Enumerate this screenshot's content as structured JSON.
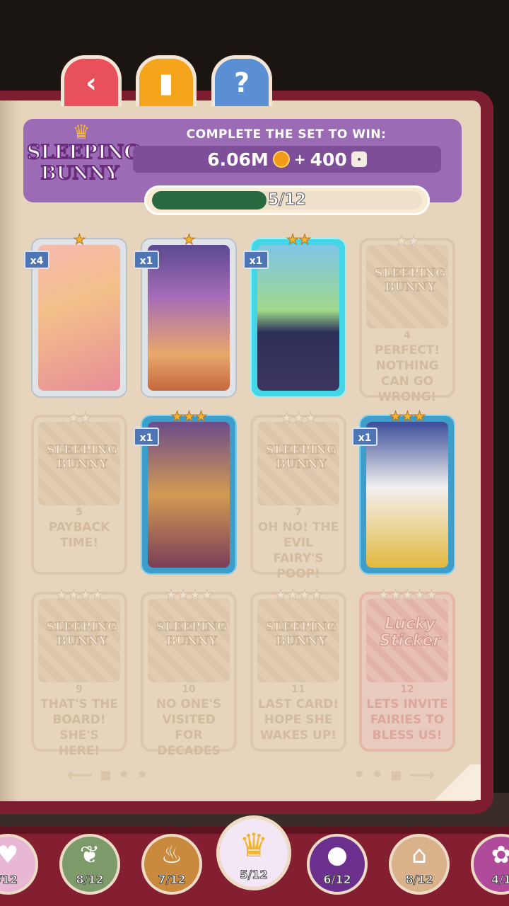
{
  "nav": {
    "back_icon": "‹",
    "cards_icon": "▮",
    "help_icon": "?"
  },
  "set": {
    "logo_line1": "SLEEPING",
    "logo_line2": "BUNNY",
    "complete_text": "COMPLETE THE SET TO WIN:",
    "reward_coins": "6.06M",
    "plus": "+",
    "reward_dice": "400",
    "progress_text": "5/12",
    "progress_fraction": 0.4167
  },
  "cards": [
    {
      "count": "x4",
      "stars": 1,
      "state": "owned",
      "frame": "silver"
    },
    {
      "count": "x1",
      "stars": 1,
      "state": "owned",
      "frame": "silver"
    },
    {
      "count": "x1",
      "stars": 2,
      "state": "owned",
      "frame": "cyan"
    },
    {
      "number": "4",
      "name": "PERFECT! NOTHING CAN GO WRONG!",
      "stars": 2,
      "state": "missing"
    },
    {
      "number": "5",
      "name": "PAYBACK TIME!",
      "stars": 2,
      "state": "missing"
    },
    {
      "count": "x1",
      "stars": 3,
      "state": "owned",
      "frame": "blue"
    },
    {
      "number": "7",
      "name": "OH NO! THE EVIL FAIRY'S POOP!",
      "stars": 3,
      "state": "missing"
    },
    {
      "count": "x1",
      "stars": 3,
      "state": "owned",
      "frame": "blue"
    },
    {
      "number": "9",
      "name": "THAT'S THE BOARD! SHE'S HERE!",
      "stars": 4,
      "state": "missing"
    },
    {
      "number": "10",
      "name": "NO ONE'S VISITED FOR DECADES",
      "stars": 4,
      "state": "missing"
    },
    {
      "number": "11",
      "name": "LAST CARD! HOPE SHE WAKES UP!",
      "stars": 4,
      "state": "missing"
    },
    {
      "number": "12",
      "name": "LETS INVITE FAIRIES TO BLESS US!",
      "stars": 5,
      "state": "missing",
      "lucky_line1": "Lucky",
      "lucky_line2": "Sticker"
    }
  ],
  "ghost_logo": "SLEEPING BUNNY",
  "collections": [
    {
      "label": "/12",
      "icon": "pig-icon"
    },
    {
      "label": "8/12",
      "icon": "vine-icon"
    },
    {
      "label": "7/12",
      "icon": "lamp-icon"
    },
    {
      "label": "5/12",
      "icon": "crown-icon",
      "selected": true
    },
    {
      "label": "6/12",
      "icon": "cauldron-icon"
    },
    {
      "label": "8/12",
      "icon": "basket-icon"
    },
    {
      "label": "4/1",
      "icon": "bow-icon"
    }
  ],
  "colors": {
    "header": "#9b6bb5",
    "progress": "#2a6a40",
    "bar": "#841f32"
  }
}
